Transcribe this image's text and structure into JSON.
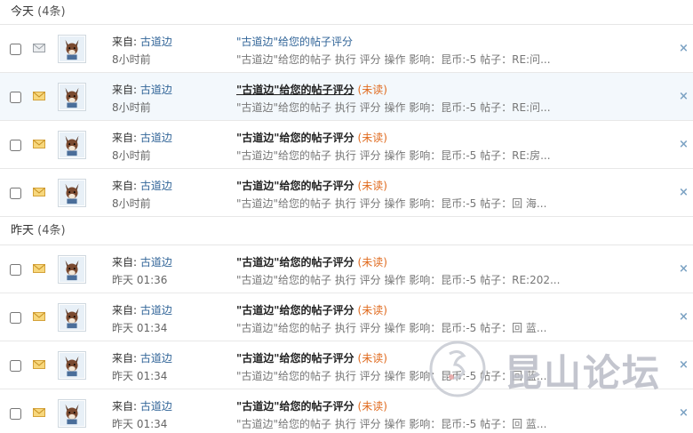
{
  "groups": [
    {
      "label": "今天",
      "count": "(4条)",
      "rows": [
        {
          "read": true,
          "from_label": "来自:",
          "sender": "古道边",
          "time": "8小时前",
          "subject": "\"古道边\"给您的帖子评分",
          "unread_tag": "",
          "summary": "\"古道边\"给您的帖子 执行 评分 操作 影响：昆币:-5 帖子：RE:问..."
        },
        {
          "read": false,
          "from_label": "来自:",
          "sender": "古道边",
          "time": "8小时前",
          "subject": "\"古道边\"给您的帖子评分",
          "unread_tag": "(未读)",
          "summary": "\"古道边\"给您的帖子 执行 评分 操作 影响：昆币:-5 帖子：RE:问..."
        },
        {
          "read": false,
          "from_label": "来自:",
          "sender": "古道边",
          "time": "8小时前",
          "subject": "\"古道边\"给您的帖子评分",
          "unread_tag": "(未读)",
          "summary": "\"古道边\"给您的帖子 执行 评分 操作 影响：昆币:-5 帖子：RE:房..."
        },
        {
          "read": false,
          "from_label": "来自:",
          "sender": "古道边",
          "time": "8小时前",
          "subject": "\"古道边\"给您的帖子评分",
          "unread_tag": "(未读)",
          "summary": "\"古道边\"给您的帖子 执行 评分 操作 影响：昆币:-5 帖子：回 海..."
        }
      ]
    },
    {
      "label": "昨天",
      "count": "(4条)",
      "rows": [
        {
          "read": false,
          "from_label": "来自:",
          "sender": "古道边",
          "time": "昨天 01:36",
          "subject": "\"古道边\"给您的帖子评分",
          "unread_tag": "(未读)",
          "summary": "\"古道边\"给您的帖子 执行 评分 操作 影响：昆币:-5 帖子：RE:202..."
        },
        {
          "read": false,
          "from_label": "来自:",
          "sender": "古道边",
          "time": "昨天 01:34",
          "subject": "\"古道边\"给您的帖子评分",
          "unread_tag": "(未读)",
          "summary": "\"古道边\"给您的帖子 执行 评分 操作 影响：昆币:-5 帖子：回 蓝..."
        },
        {
          "read": false,
          "from_label": "来自:",
          "sender": "古道边",
          "time": "昨天 01:34",
          "subject": "\"古道边\"给您的帖子评分",
          "unread_tag": "(未读)",
          "summary": "\"古道边\"给您的帖子 执行 评分 操作 影响：昆币:-5 帖子：回 蓝..."
        },
        {
          "read": false,
          "from_label": "来自:",
          "sender": "古道边",
          "time": "昨天 01:34",
          "subject": "\"古道边\"给您的帖子评分",
          "unread_tag": "(未读)",
          "summary": "\"古道边\"给您的帖子 执行 评分 操作 影响：昆币:-5 帖子：回 蓝..."
        }
      ]
    }
  ],
  "delete_icon_glyph": "×",
  "watermark_text": "昆山论坛",
  "colors": {
    "link": "#336699",
    "unread": "#e06b1f",
    "envelope_unread": "#e8b84a",
    "envelope_read": "#9aa0a6"
  }
}
